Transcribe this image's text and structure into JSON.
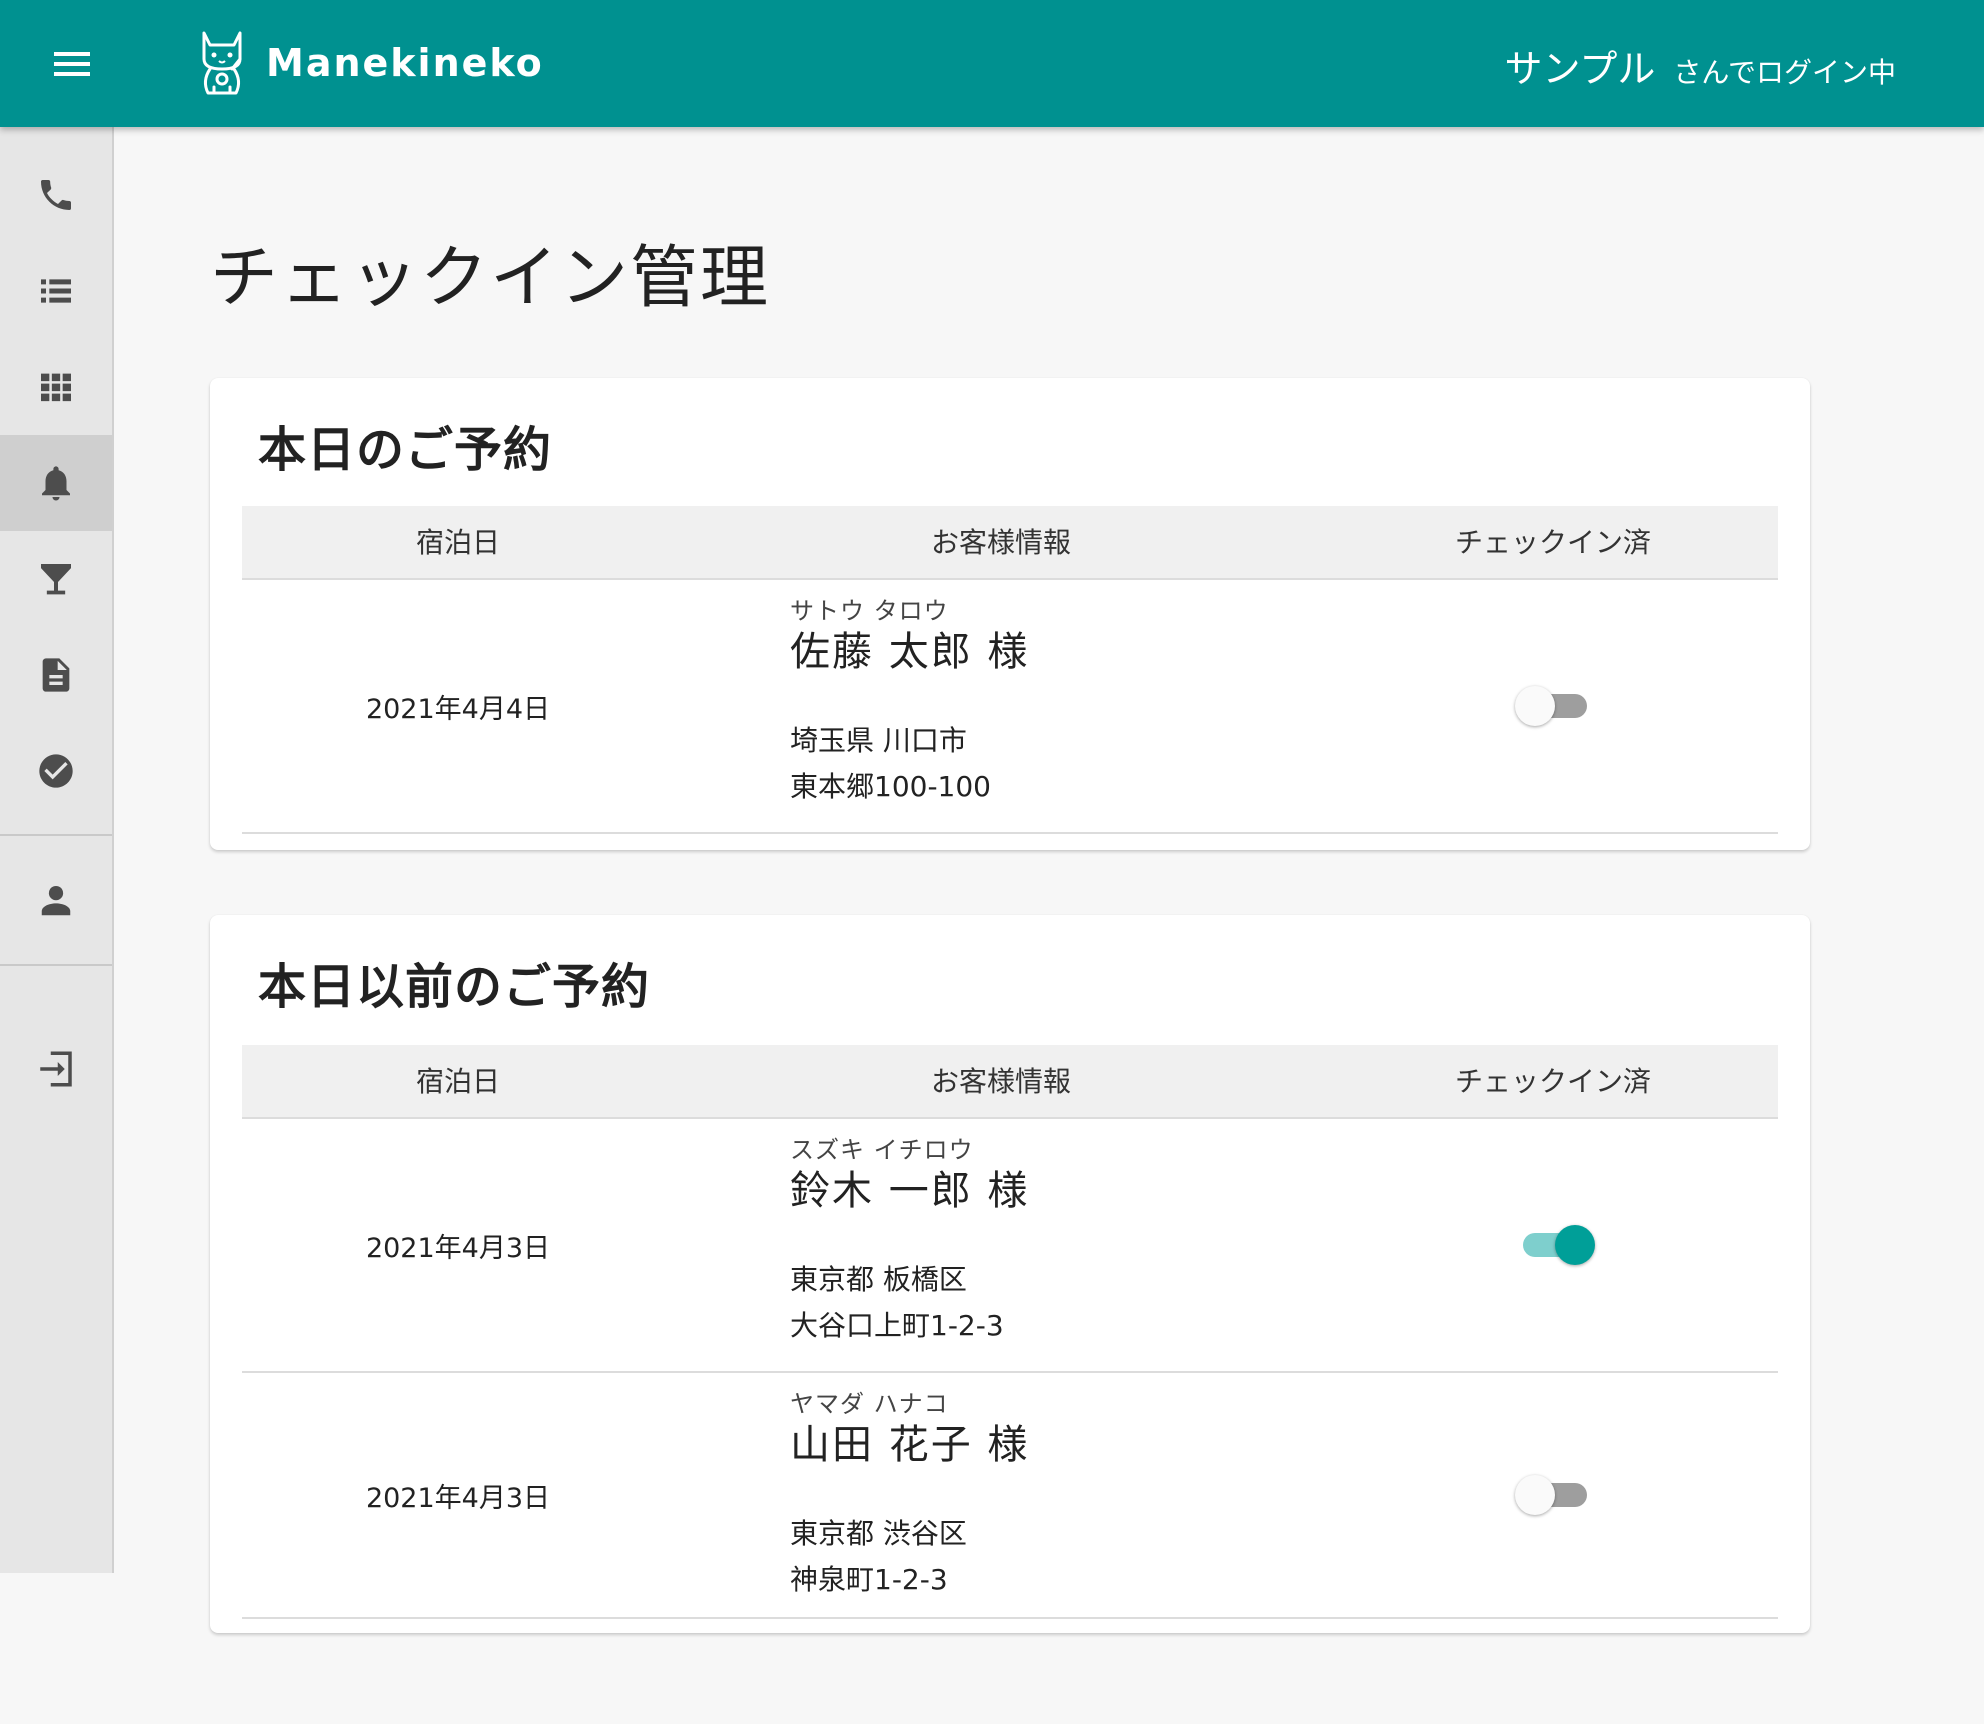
{
  "app": {
    "logo_text": "Manekineko",
    "user_name": "サンプル",
    "user_suffix": "さんでログイン中"
  },
  "sidebar": {
    "items": [
      {
        "icon": "phone-icon"
      },
      {
        "icon": "list-icon"
      },
      {
        "icon": "grid-icon"
      },
      {
        "icon": "bell-icon",
        "active": true
      },
      {
        "icon": "cocktail-icon"
      },
      {
        "icon": "document-icon"
      },
      {
        "icon": "check-circle-icon"
      },
      {
        "icon": "person-icon"
      },
      {
        "icon": "logout-icon"
      }
    ]
  },
  "page": {
    "title": "チェックイン管理"
  },
  "table_headers": {
    "date": "宿泊日",
    "info": "お客様情報",
    "checkin": "チェックイン済"
  },
  "today": {
    "title": "本日のご予約",
    "rows": [
      {
        "date": "2021年4月4日",
        "kana": "サトウ タロウ",
        "name": "佐藤 太郎 様",
        "addr1": "埼玉県 川口市",
        "addr2": "東本郷100-100",
        "checked_in": false
      }
    ]
  },
  "past": {
    "title": "本日以前のご予約",
    "rows": [
      {
        "date": "2021年4月3日",
        "kana": "スズキ イチロウ",
        "name": "鈴木 一郎 様",
        "addr1": "東京都 板橋区",
        "addr2": "大谷口上町1-2-3",
        "checked_in": true
      },
      {
        "date": "2021年4月3日",
        "kana": "ヤマダ ハナコ",
        "name": "山田 花子 様",
        "addr1": "東京都 渋谷区",
        "addr2": "神泉町1-2-3",
        "checked_in": false
      }
    ]
  },
  "colors": {
    "primary": "#009190",
    "switch_on": "#009f98",
    "switch_on_track": "#7ecfcd",
    "switch_off_track": "#9e9e9e"
  }
}
